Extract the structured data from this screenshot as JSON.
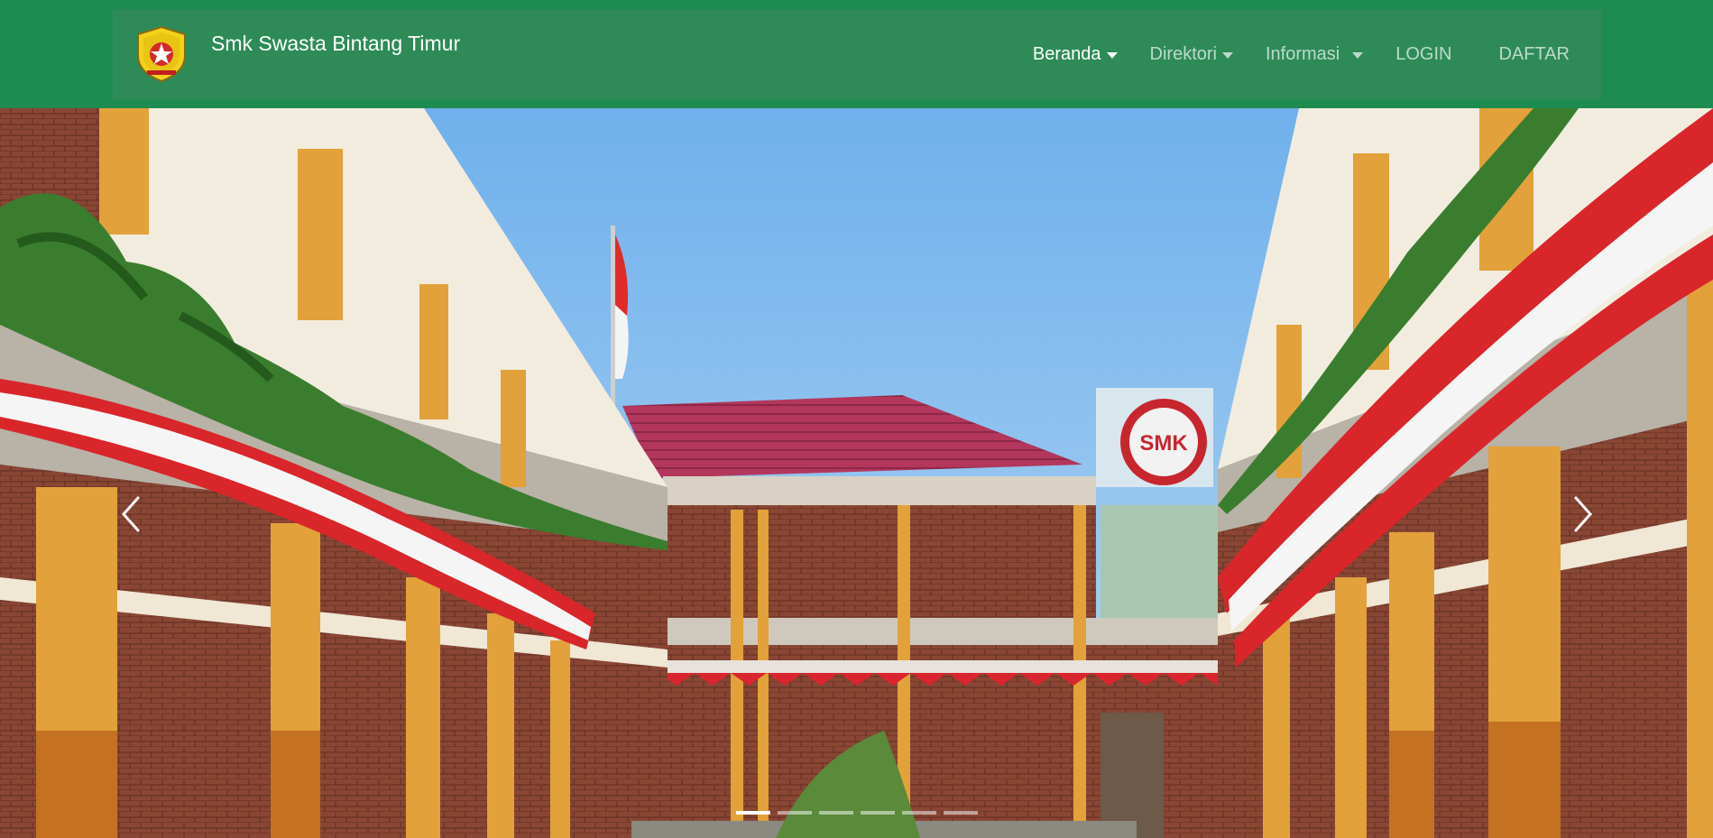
{
  "header": {
    "brand_name": "Smk Swasta Bintang Timur",
    "logo_icon": "school-emblem-icon",
    "nav": [
      {
        "label": "Beranda",
        "has_dropdown": true,
        "active": true
      },
      {
        "label": "Direktori",
        "has_dropdown": true,
        "active": false
      },
      {
        "label": "Informasi",
        "has_dropdown": true,
        "active": false
      },
      {
        "label": "LOGIN",
        "has_dropdown": false,
        "active": false
      },
      {
        "label": "DAFTAR",
        "has_dropdown": false,
        "active": false
      }
    ]
  },
  "carousel": {
    "prev_icon": "chevron-left-icon",
    "next_icon": "chevron-right-icon",
    "slide_count": 6,
    "active_index": 0,
    "emblem_text": "SMK"
  },
  "colors": {
    "header_bg": "#1e8c50",
    "navbar_bg": "#2e8b57",
    "sky": "#8fc3ef",
    "roof": "#b0335a",
    "brick": "#8b4a35",
    "pillar": "#e2a13a"
  }
}
